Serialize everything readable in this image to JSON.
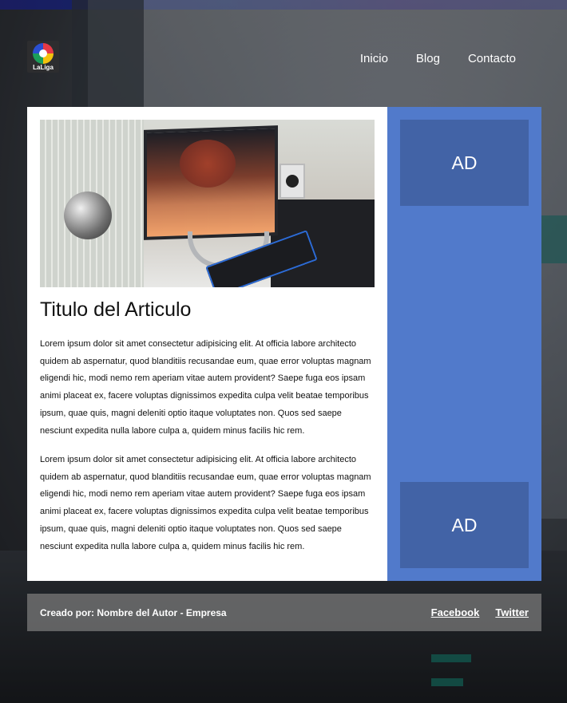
{
  "header": {
    "logo_text": "LaLiga",
    "nav": [
      {
        "label": "Inicio"
      },
      {
        "label": "Blog"
      },
      {
        "label": "Contacto"
      }
    ]
  },
  "article": {
    "image_description": "desk-setup-photo",
    "title": "Titulo del Articulo",
    "paragraphs": [
      "Lorem ipsum dolor sit amet consectetur adipisicing elit. At officia labore architecto quidem ab aspernatur, quod blanditiis recusandae eum, quae error voluptas magnam eligendi hic, modi nemo rem aperiam vitae autem provident? Saepe fuga eos ipsam animi placeat ex, facere voluptas dignissimos expedita culpa velit beatae temporibus ipsum, quae quis, magni deleniti optio itaque voluptates non. Quos sed saepe nesciunt expedita nulla labore culpa a, quidem minus facilis hic rem.",
      "Lorem ipsum dolor sit amet consectetur adipisicing elit. At officia labore architecto quidem ab aspernatur, quod blanditiis recusandae eum, quae error voluptas magnam eligendi hic, modi nemo rem aperiam vitae autem provident? Saepe fuga eos ipsam animi placeat ex, facere voluptas dignissimos expedita culpa velit beatae temporibus ipsum, quae quis, magni deleniti optio itaque voluptates non. Quos sed saepe nesciunt expedita nulla labore culpa a, quidem minus facilis hic rem."
    ]
  },
  "sidebar": {
    "ads": [
      {
        "label": "AD"
      },
      {
        "label": "AD"
      }
    ]
  },
  "footer": {
    "credit": "Creado por: Nombre del Autor - Empresa",
    "links": [
      {
        "label": "Facebook"
      },
      {
        "label": "Twitter"
      }
    ]
  },
  "colors": {
    "sidebar": "#517acb",
    "ad_box": "#4263a6",
    "card": "#ffffff",
    "footer": "#7d7d7d"
  }
}
